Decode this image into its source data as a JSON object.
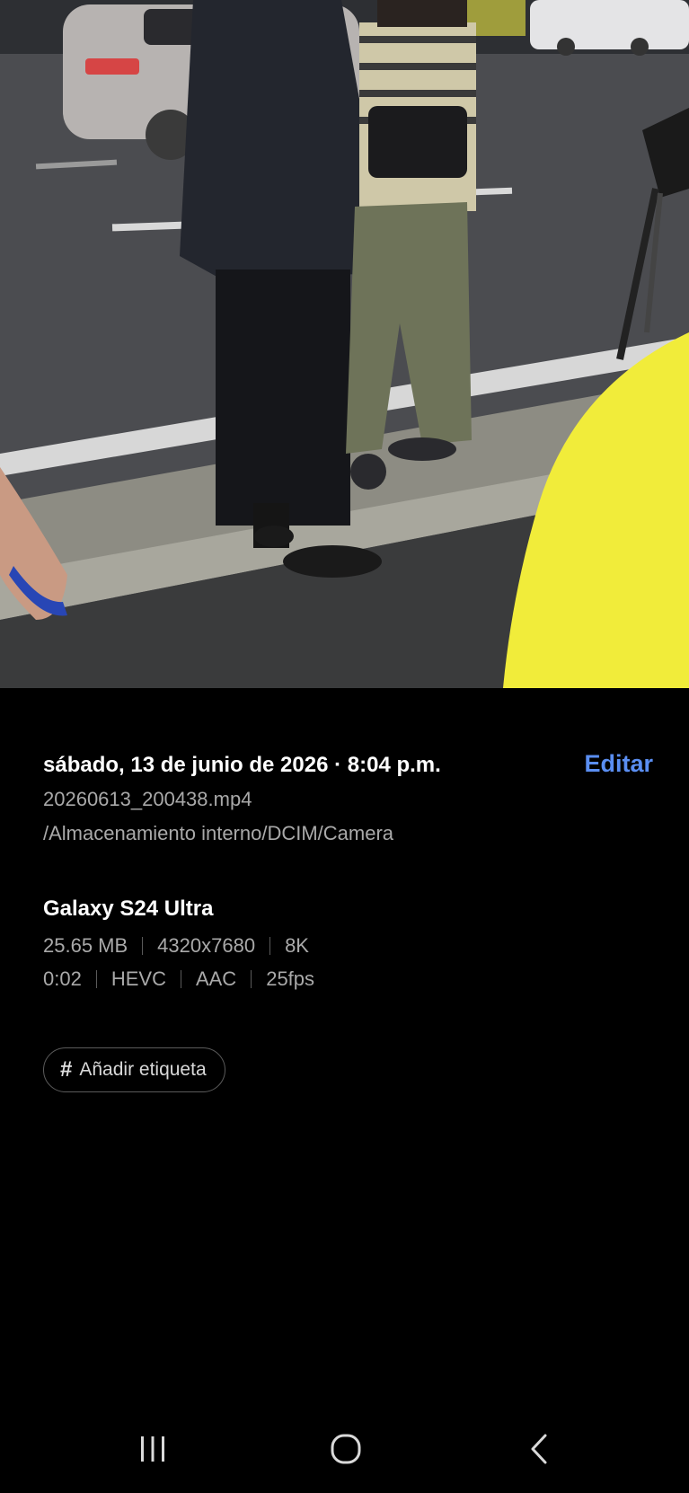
{
  "photo": {
    "icon": "video-thumbnail"
  },
  "details": {
    "date_time": "sábado, 13 de junio de 2026 · 8:04 p.m.",
    "edit_label": "Editar",
    "file_name": "20260613_200438.mp4",
    "file_path": "/Almacenamiento interno/DCIM/Camera",
    "device": "Galaxy S24 Ultra",
    "specs_row1": [
      "25.65 MB",
      "4320x7680",
      "8K"
    ],
    "specs_row2": [
      "0:02",
      "HEVC",
      "AAC",
      "25fps"
    ],
    "tag_label": "Añadir etiqueta",
    "tag_icon": "hash-icon"
  },
  "navbar": {
    "recent_icon": "recent-apps-icon",
    "home_icon": "home-icon",
    "back_icon": "back-icon"
  },
  "colors": {
    "accent": "#5a8ef2",
    "background": "#000000",
    "secondary_text": "#a9a9a9"
  }
}
